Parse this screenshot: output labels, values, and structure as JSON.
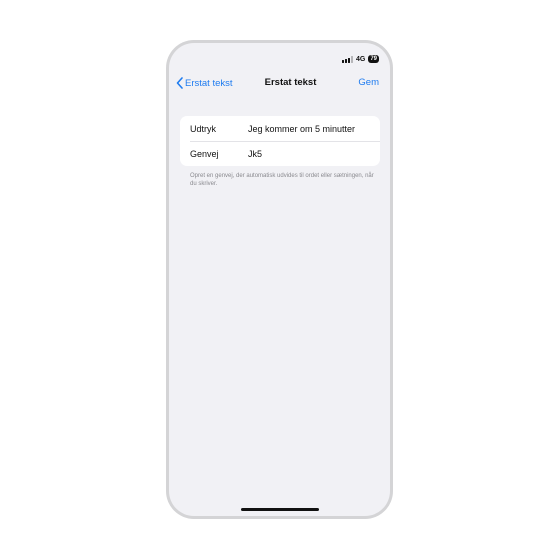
{
  "status_bar": {
    "network": "4G",
    "battery": "79",
    "signal_bars_active": 3,
    "signal_bars_total": 4
  },
  "nav": {
    "back_label": "Erstat tekst",
    "title": "Erstat tekst",
    "save_label": "Gem"
  },
  "form": {
    "rows": [
      {
        "label": "Udtryk",
        "value": "Jeg kommer om 5 minutter"
      },
      {
        "label": "Genvej",
        "value": "Jk5"
      }
    ],
    "footnote": "Opret en genvej, der automatisk udvides til ordet eller sætningen, når du skriver."
  },
  "colors": {
    "accent": "#1f7cf0",
    "background": "#f1f1f5",
    "card": "#ffffff",
    "secondary_text": "#8a8a8f"
  },
  "icons": {
    "back": "chevron-left-icon",
    "signal": "cellular-signal-icon",
    "battery": "battery-icon"
  }
}
